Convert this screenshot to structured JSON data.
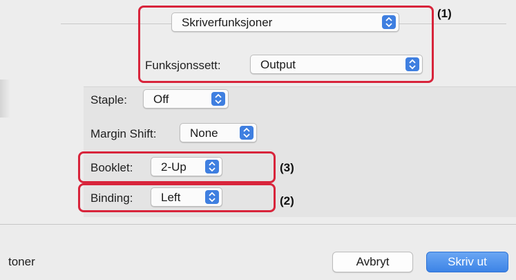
{
  "header": {
    "panel_select": "Skriverfunksjoner",
    "feature_set_label": "Funksjonssett:",
    "feature_set_value": "Output"
  },
  "options": {
    "staple_label": "Staple:",
    "staple_value": "Off",
    "margin_shift_label": "Margin Shift:",
    "margin_shift_value": "None",
    "booklet_label": "Booklet:",
    "booklet_value": "2-Up",
    "binding_label": "Binding:",
    "binding_value": "Left"
  },
  "callouts": {
    "one": "(1)",
    "two": "(2)",
    "three": "(3)"
  },
  "footer": {
    "left_text": "toner",
    "cancel_label": "Avbryt",
    "print_label": "Skriv ut"
  },
  "colors": {
    "accent": "#3f7fe0",
    "callout": "#d8243b"
  }
}
